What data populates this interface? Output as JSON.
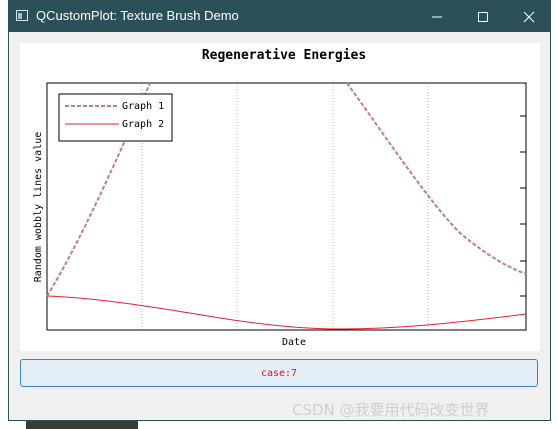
{
  "window": {
    "title": "QCustomPlot: Texture Brush Demo",
    "title_bar_color": "#2b5057",
    "controls": {
      "minimize_icon": "minimize-icon",
      "maximize_icon": "maximize-icon",
      "close_icon": "close-icon"
    }
  },
  "chart_data": {
    "type": "line",
    "title": "Regenerative Energies",
    "xlabel": "Date",
    "ylabel": "Random wobbly lines value",
    "x_tick_labels": [],
    "y_tick_labels": [],
    "grid": {
      "x": true,
      "y": false,
      "style": "dotted"
    },
    "legend_placement": "top-left",
    "series": [
      {
        "name": "Graph 1",
        "style": "dashed",
        "color": "#c08080"
      },
      {
        "name": "Graph 2",
        "style": "solid",
        "color": "#e8202a"
      }
    ]
  },
  "button": {
    "label": "case:7",
    "text_color": "#d11a1a",
    "background": "#e2edf7"
  },
  "watermark": "CSDN @我要用代码改变世界"
}
